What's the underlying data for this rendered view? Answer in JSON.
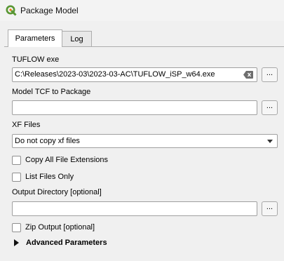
{
  "window": {
    "title": "Package Model",
    "icon": "qgis-logo-icon"
  },
  "tabs": [
    {
      "label": "Parameters",
      "active": true
    },
    {
      "label": "Log",
      "active": false
    }
  ],
  "params": {
    "tuflow_exe": {
      "label": "TUFLOW exe",
      "value": "C:\\Releases\\2023-03\\2023-03-AC\\TUFLOW_iSP_w64.exe",
      "browse": "..."
    },
    "model_tcf": {
      "label": "Model TCF to Package",
      "value": "",
      "browse": "..."
    },
    "xf_files": {
      "label": "XF Files",
      "selected": "Do not copy xf files"
    },
    "copy_all_ext": {
      "label": "Copy All File Extensions",
      "checked": false
    },
    "list_only": {
      "label": "List Files Only",
      "checked": false
    },
    "output_dir": {
      "label": "Output Directory [optional]",
      "value": "",
      "browse": "..."
    },
    "zip_output": {
      "label": "Zip Output [optional]",
      "checked": false
    },
    "advanced": {
      "label": "Advanced Parameters"
    }
  },
  "colors": {
    "qgis_green": "#589632",
    "qgis_yellow": "#ee7913"
  }
}
